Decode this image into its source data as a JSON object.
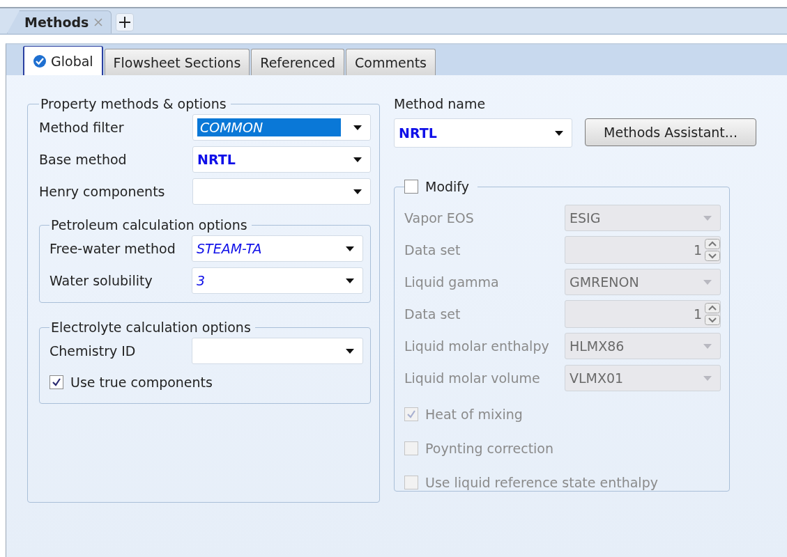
{
  "doc_tabs": [
    {
      "label": "Methods"
    }
  ],
  "tabs": [
    {
      "label": "Global",
      "selected": true,
      "complete": true
    },
    {
      "label": "Flowsheet Sections",
      "selected": false,
      "complete": false
    },
    {
      "label": "Referenced",
      "selected": false,
      "complete": false
    },
    {
      "label": "Comments",
      "selected": false,
      "complete": false
    }
  ],
  "property_methods": {
    "title": "Property methods & options",
    "fields": [
      {
        "label": "Method filter",
        "value": "COMMON",
        "kind": "default",
        "highlighted": true
      },
      {
        "label": "Base method",
        "value": "NRTL",
        "kind": "entered",
        "highlighted": false
      },
      {
        "label": "Henry components"
      }
    ]
  },
  "petroleum": {
    "title": "Petroleum calculation options",
    "fields": [
      {
        "label": "Free-water method",
        "value": "STEAM-TA",
        "kind": "default",
        "highlighted": false
      },
      {
        "label": "Water solubility",
        "value": "3",
        "kind": "default",
        "highlighted": false
      }
    ]
  },
  "electrolyte": {
    "title": "Electrolyte calculation options",
    "fields": [
      {
        "label": "Chemistry ID"
      }
    ],
    "checkboxes": [
      {
        "label": "Use true components",
        "checked": true
      }
    ]
  },
  "method_name": {
    "label": "Method name",
    "value": "NRTL",
    "kind": "entered"
  },
  "assistant_button": "Methods Assistant...",
  "modify": {
    "label": "Modify",
    "checked": false,
    "rows": [
      {
        "kind": "dropdown",
        "label": "Vapor EOS",
        "value": "ESIG"
      },
      {
        "kind": "spinner",
        "label": "Data set",
        "value": "1"
      },
      {
        "kind": "dropdown",
        "label": "Liquid gamma",
        "value": "GMRENON"
      },
      {
        "kind": "spinner",
        "label": "Data set",
        "value": "1"
      },
      {
        "kind": "dropdown",
        "label": "Liquid molar enthalpy",
        "value": "HLMX86"
      },
      {
        "kind": "dropdown",
        "label": "Liquid molar volume",
        "value": "VLMX01"
      }
    ],
    "checkboxes": [
      {
        "label": "Heat of mixing",
        "checked": true
      },
      {
        "label": "Poynting correction",
        "checked": false
      },
      {
        "label": "Use liquid reference state enthalpy",
        "checked": false
      }
    ]
  }
}
